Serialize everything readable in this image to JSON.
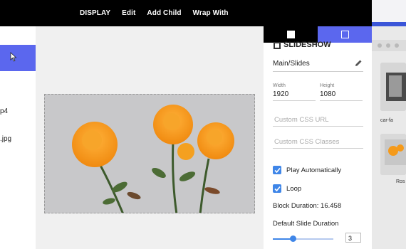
{
  "menu": {
    "items": [
      "DISPLAY",
      "Edit",
      "Add Child",
      "Wrap With"
    ]
  },
  "left_panel": {
    "items": [
      "p4",
      ".jpg"
    ]
  },
  "properties": {
    "title": "SLIDESHOW",
    "path": "Main/Slides",
    "width_label": "Width",
    "width_value": "1920",
    "height_label": "Height",
    "height_value": "1080",
    "css_url_placeholder": "Custom CSS URL",
    "css_classes_placeholder": "Custom CSS Classes",
    "play_auto_label": "Play Automatically",
    "play_auto_checked": true,
    "loop_label": "Loop",
    "loop_checked": true,
    "block_duration_text": "Block Duration: 16.458",
    "slide_duration_label": "Default Slide Duration",
    "slide_duration_value": "3",
    "slide_duration_slider_fraction": 0.34
  },
  "right_window": {
    "thumb1_caption": "car-fa",
    "thumb2_caption": "Ros"
  },
  "colors": {
    "accent": "#5b67ee",
    "checkbox": "#3f86e8"
  }
}
